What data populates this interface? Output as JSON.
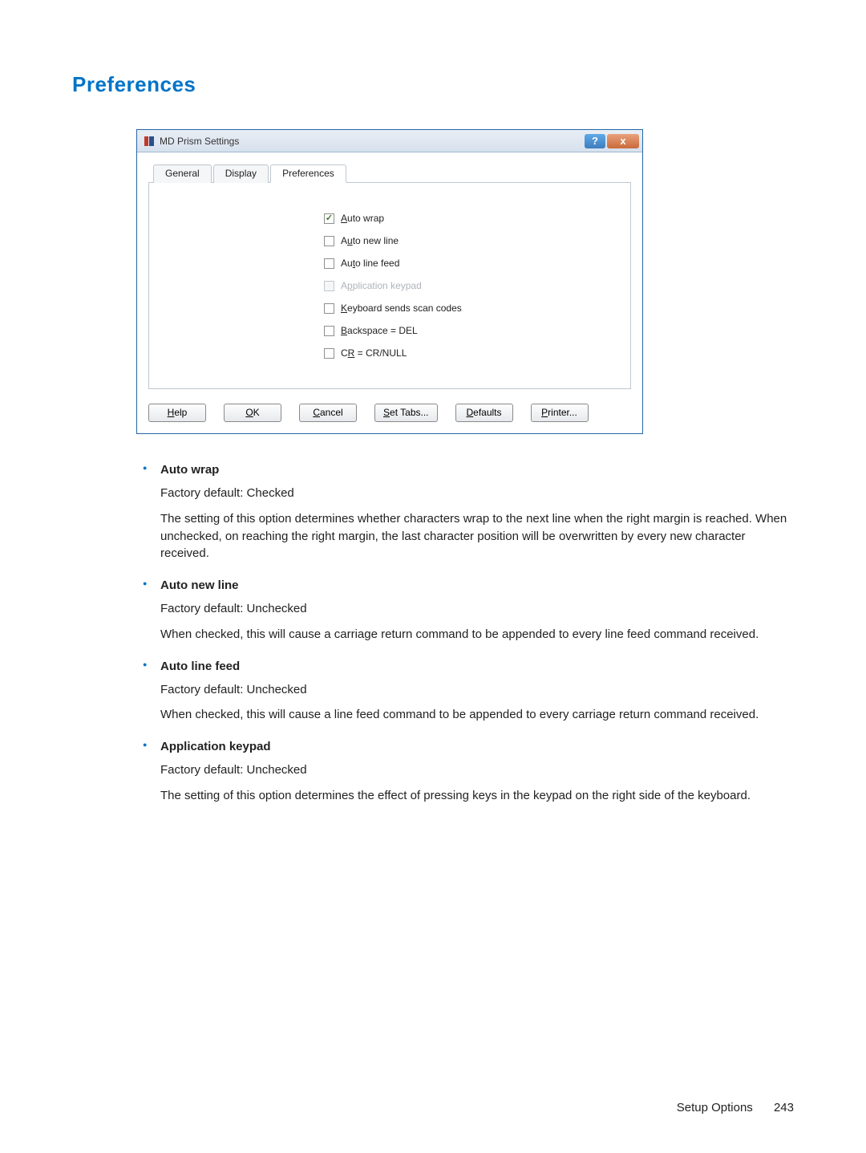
{
  "heading": "Preferences",
  "dialog": {
    "title": "MD Prism Settings",
    "tabs": [
      "General",
      "Display",
      "Preferences"
    ],
    "active_tab": 2,
    "checkboxes": [
      {
        "label_pre": "",
        "ul": "A",
        "label_post": "uto wrap",
        "checked": true,
        "disabled": false
      },
      {
        "label_pre": "A",
        "ul": "u",
        "label_post": "to new line",
        "checked": false,
        "disabled": false
      },
      {
        "label_pre": "Au",
        "ul": "t",
        "label_post": "o line feed",
        "checked": false,
        "disabled": false
      },
      {
        "label_pre": "A",
        "ul": "p",
        "label_post": "plication keypad",
        "checked": false,
        "disabled": true
      },
      {
        "label_pre": "",
        "ul": "K",
        "label_post": "eyboard sends scan codes",
        "checked": false,
        "disabled": false
      },
      {
        "label_pre": "",
        "ul": "B",
        "label_post": "ackspace = DEL",
        "checked": false,
        "disabled": false
      },
      {
        "label_pre": "C",
        "ul": "R",
        "label_post": " = CR/NULL",
        "checked": false,
        "disabled": false
      }
    ],
    "buttons": {
      "help": "Help",
      "ok": "OK",
      "cancel": "Cancel",
      "set_tabs": "Set Tabs...",
      "defaults": "Defaults",
      "printer": "Printer..."
    }
  },
  "docs": [
    {
      "term": "Auto wrap",
      "default": "Factory default: Checked",
      "desc": "The setting of this option determines whether characters wrap to the next line when the right margin is reached. When unchecked, on reaching the right margin, the last character position will be overwritten by every new character received."
    },
    {
      "term": "Auto new line",
      "default": "Factory default: Unchecked",
      "desc": "When checked, this will cause a carriage return command to be appended to every line feed command received."
    },
    {
      "term": "Auto line feed",
      "default": "Factory default: Unchecked",
      "desc": "When checked, this will cause a line feed command to be appended to every carriage return command received."
    },
    {
      "term": "Application keypad",
      "default": "Factory default: Unchecked",
      "desc": "The setting of this option determines the effect of pressing keys in the keypad on the right side of the keyboard."
    }
  ],
  "footer": {
    "section": "Setup Options",
    "page": "243"
  }
}
